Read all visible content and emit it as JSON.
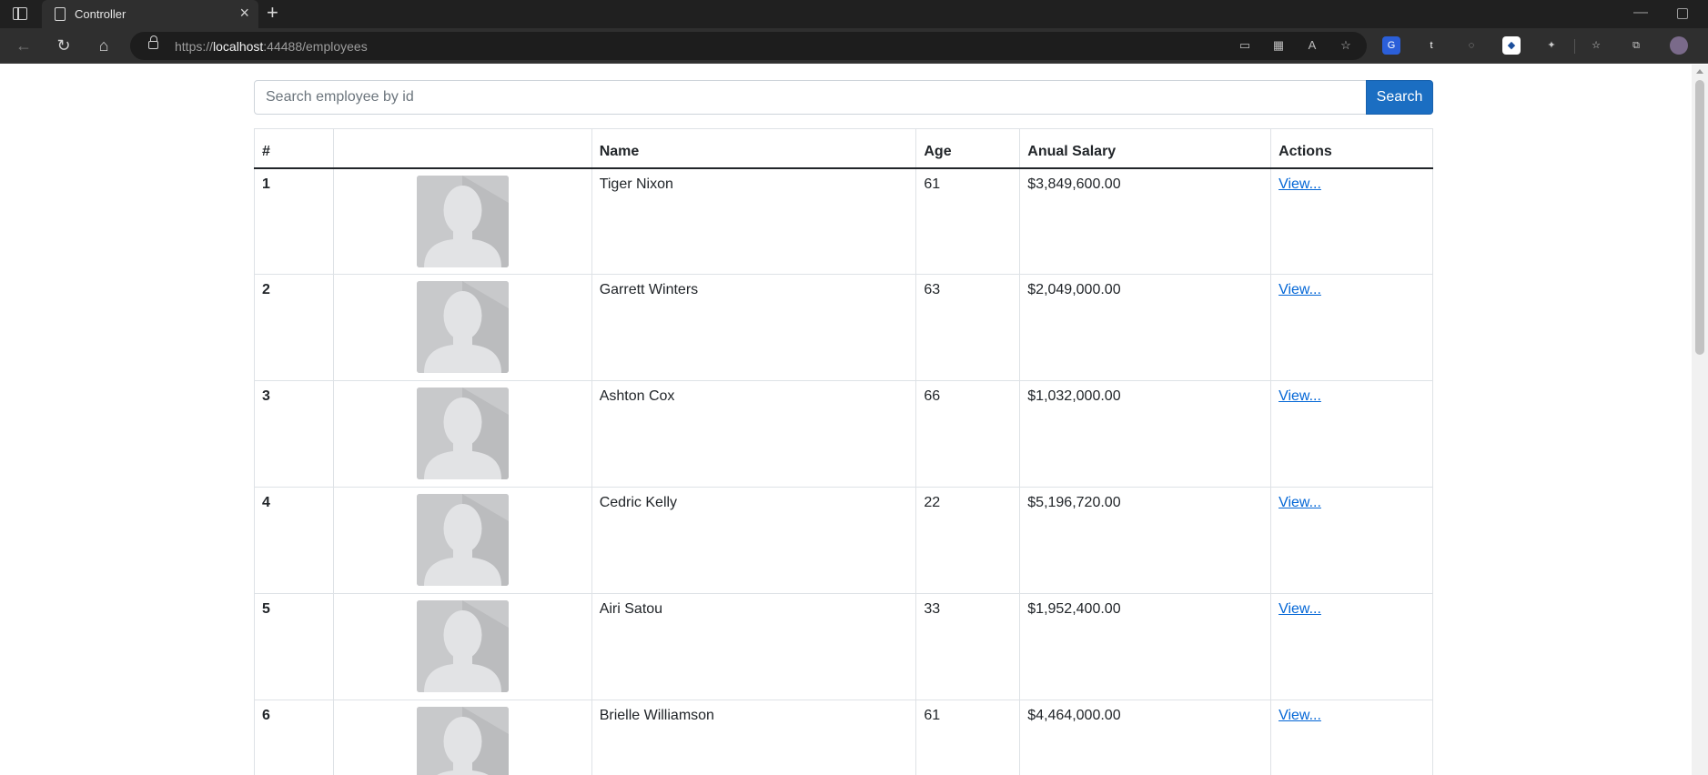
{
  "browser": {
    "tab_title": "Controller",
    "url_scheme": "https://",
    "url_host": "localhost",
    "url_rest": ":44488/employees"
  },
  "search": {
    "placeholder": "Search employee by id",
    "button_label": "Search"
  },
  "table": {
    "headers": [
      "#",
      "",
      "Name",
      "Age",
      "Anual Salary",
      "Actions"
    ],
    "rows": [
      {
        "index": "1",
        "name": "Tiger Nixon",
        "age": "61",
        "salary": "$3,849,600.00",
        "action": "View..."
      },
      {
        "index": "2",
        "name": "Garrett Winters",
        "age": "63",
        "salary": "$2,049,000.00",
        "action": "View..."
      },
      {
        "index": "3",
        "name": "Ashton Cox",
        "age": "66",
        "salary": "$1,032,000.00",
        "action": "View..."
      },
      {
        "index": "4",
        "name": "Cedric Kelly",
        "age": "22",
        "salary": "$5,196,720.00",
        "action": "View..."
      },
      {
        "index": "5",
        "name": "Airi Satou",
        "age": "33",
        "salary": "$1,952,400.00",
        "action": "View..."
      },
      {
        "index": "6",
        "name": "Brielle Williamson",
        "age": "61",
        "salary": "$4,464,000.00",
        "action": "View..."
      }
    ]
  },
  "icons": {
    "avatar": "default-user-avatar-icon"
  },
  "colors": {
    "primary": "#1b6ec2",
    "link": "#0366d6",
    "browser_chrome": "#2f2f2f"
  }
}
